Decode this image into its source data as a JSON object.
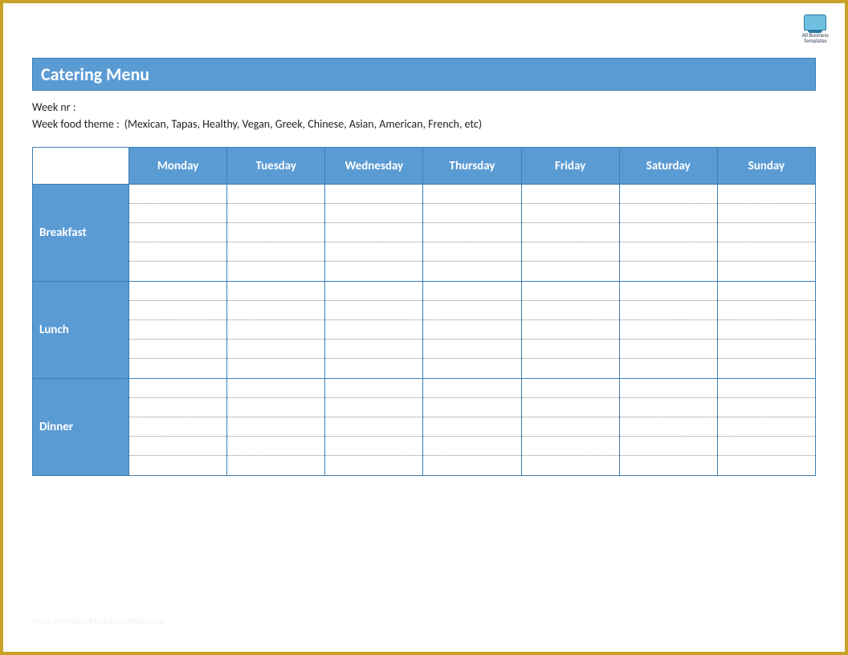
{
  "watermark": {
    "line1": "All Business",
    "line2": "Templates"
  },
  "title": "Catering Menu",
  "meta": {
    "week_nr_label": "Week nr :",
    "week_nr_value": "",
    "theme_label": "Week food theme :",
    "theme_value": "(Mexican, Tapas, Healthy, Vegan, Greek, Chinese, Asian, American, French, etc)"
  },
  "days": [
    "Monday",
    "Tuesday",
    "Wednesday",
    "Thursday",
    "Friday",
    "Saturday",
    "Sunday"
  ],
  "meals": [
    {
      "name": "Breakfast",
      "slots": 5
    },
    {
      "name": "Lunch",
      "slots": 5
    },
    {
      "name": "Dinner",
      "slots": 5
    }
  ],
  "footer_watermark": "www.heritagechristiancollege.com",
  "colors": {
    "frame": "#c9a227",
    "header_bg": "#5a9bd4",
    "header_border": "#3d7fb5"
  }
}
